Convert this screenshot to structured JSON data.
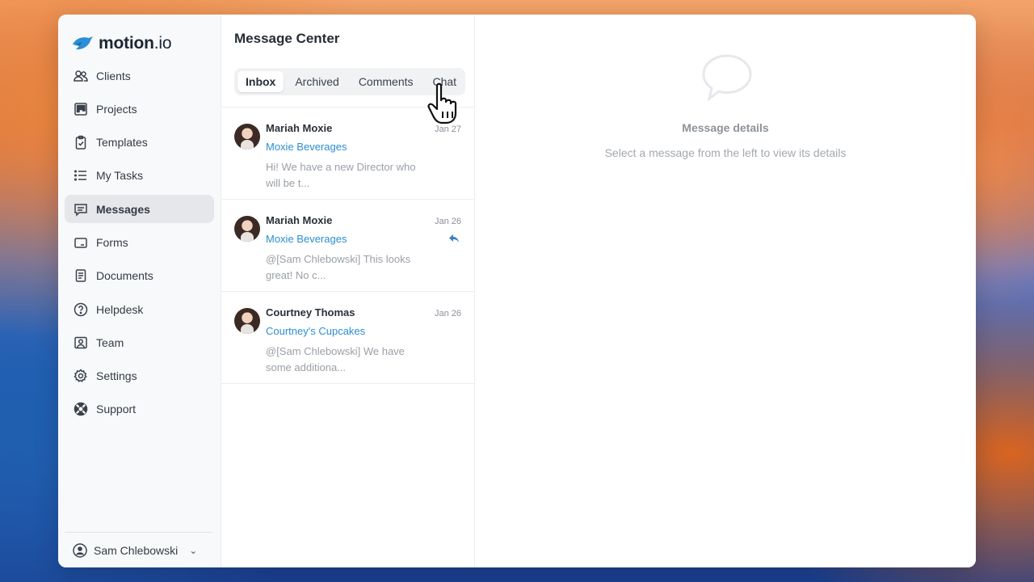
{
  "app": {
    "logo_text_main": "motion",
    "logo_text_suffix": ".io"
  },
  "sidebar": {
    "items": [
      {
        "label": "Clients",
        "icon": "users-icon"
      },
      {
        "label": "Projects",
        "icon": "kanban-icon"
      },
      {
        "label": "Templates",
        "icon": "clipboard-check-icon"
      },
      {
        "label": "My Tasks",
        "icon": "list-icon"
      },
      {
        "label": "Messages",
        "icon": "message-icon",
        "active": true
      },
      {
        "label": "Forms",
        "icon": "form-icon"
      },
      {
        "label": "Documents",
        "icon": "document-icon"
      },
      {
        "label": "Helpdesk",
        "icon": "help-circle-icon"
      },
      {
        "label": "Team",
        "icon": "team-icon"
      },
      {
        "label": "Settings",
        "icon": "gear-icon"
      },
      {
        "label": "Support",
        "icon": "lifebuoy-icon"
      }
    ],
    "user_name": "Sam Chlebowski"
  },
  "message_center": {
    "title": "Message Center",
    "tabs": [
      "Inbox",
      "Archived",
      "Comments",
      "Chat"
    ],
    "active_tab": "Inbox",
    "messages": [
      {
        "name": "Mariah Moxie",
        "date": "Jan 27",
        "company": "Moxie Beverages",
        "preview": "Hi! We have a new Director who will be t...",
        "replied": false
      },
      {
        "name": "Mariah Moxie",
        "date": "Jan 26",
        "company": "Moxie Beverages",
        "preview": "@[Sam Chlebowski] This looks great! No c...",
        "replied": true
      },
      {
        "name": "Courtney Thomas",
        "date": "Jan 26",
        "company": "Courtney's Cupcakes",
        "preview": "@[Sam Chlebowski] We have some additiona...",
        "replied": false
      }
    ]
  },
  "detail": {
    "title": "Message details",
    "subtitle": "Select a message from the left to view its details"
  },
  "colors": {
    "accent_link": "#2b8fcf",
    "logo_blue": "#2a8fd4"
  }
}
